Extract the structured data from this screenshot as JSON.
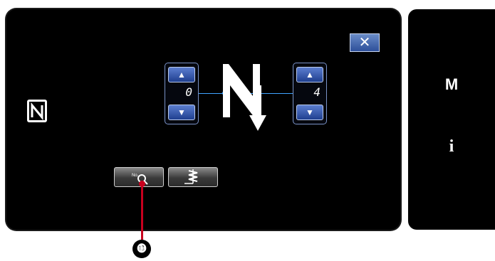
{
  "panel": {
    "close_label": "✕",
    "left_spinner": {
      "value": "0",
      "up": "▲",
      "down": "▼"
    },
    "right_spinner": {
      "value": "4",
      "up": "▲",
      "down": "▼"
    },
    "nfc_icon": "nfc-icon",
    "buttons": [
      {
        "icon": "no-search-icon",
        "label": "No."
      },
      {
        "icon": "stitch-pattern-icon"
      }
    ]
  },
  "side_menu": {
    "mode_label": "M",
    "info_label": "i"
  },
  "callout": {
    "label": "⓭"
  },
  "colors": {
    "accent": "#3fa3ff",
    "button_blue": "#2d4f9a",
    "callout_red": "#c8001e"
  }
}
